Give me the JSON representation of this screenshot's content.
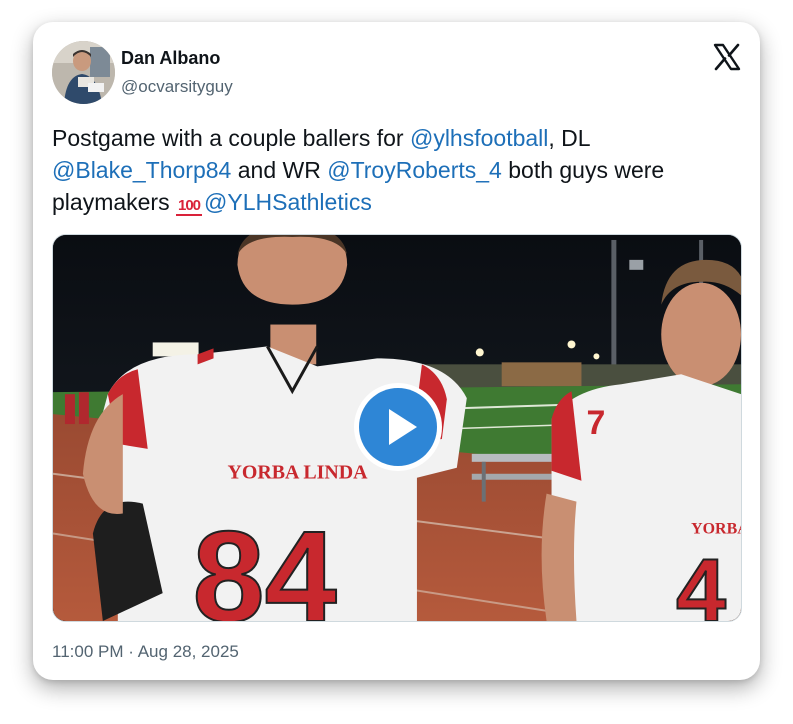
{
  "author": {
    "name": "Dan Albano",
    "handle": "@ocvarsityguy"
  },
  "platform_icon": "x-logo-icon",
  "tweet": {
    "segments": [
      {
        "text": "Postgame with a couple ballers for ",
        "type": "text"
      },
      {
        "text": "@ylhsfootball",
        "type": "mention"
      },
      {
        "text": ", DL ",
        "type": "text"
      },
      {
        "text": "@Blake_Thorp84",
        "type": "mention"
      },
      {
        "text": " and WR ",
        "type": "text"
      },
      {
        "text": "@TroyRoberts_4",
        "type": "mention"
      },
      {
        "text": " both guys were playmakers ",
        "type": "text"
      },
      {
        "text": "100",
        "type": "emoji",
        "icon": "hundred-points-emoji"
      },
      {
        "text": "@YLHSathletics",
        "type": "mention"
      }
    ]
  },
  "media": {
    "type": "video",
    "jersey_left_text": "YORBA LINDA",
    "jersey_left_number": "84",
    "jersey_right_text": "YORBA",
    "jersey_right_number": "4",
    "shoulder_number_right": "7",
    "play_icon": "play-icon"
  },
  "timestamp": {
    "time": "11:00 PM",
    "separator": "·",
    "date": "Aug 28, 2025"
  },
  "colors": {
    "mention": "#1d6fb8",
    "play_button": "#2e86d6",
    "jersey_red": "#c8282e"
  }
}
